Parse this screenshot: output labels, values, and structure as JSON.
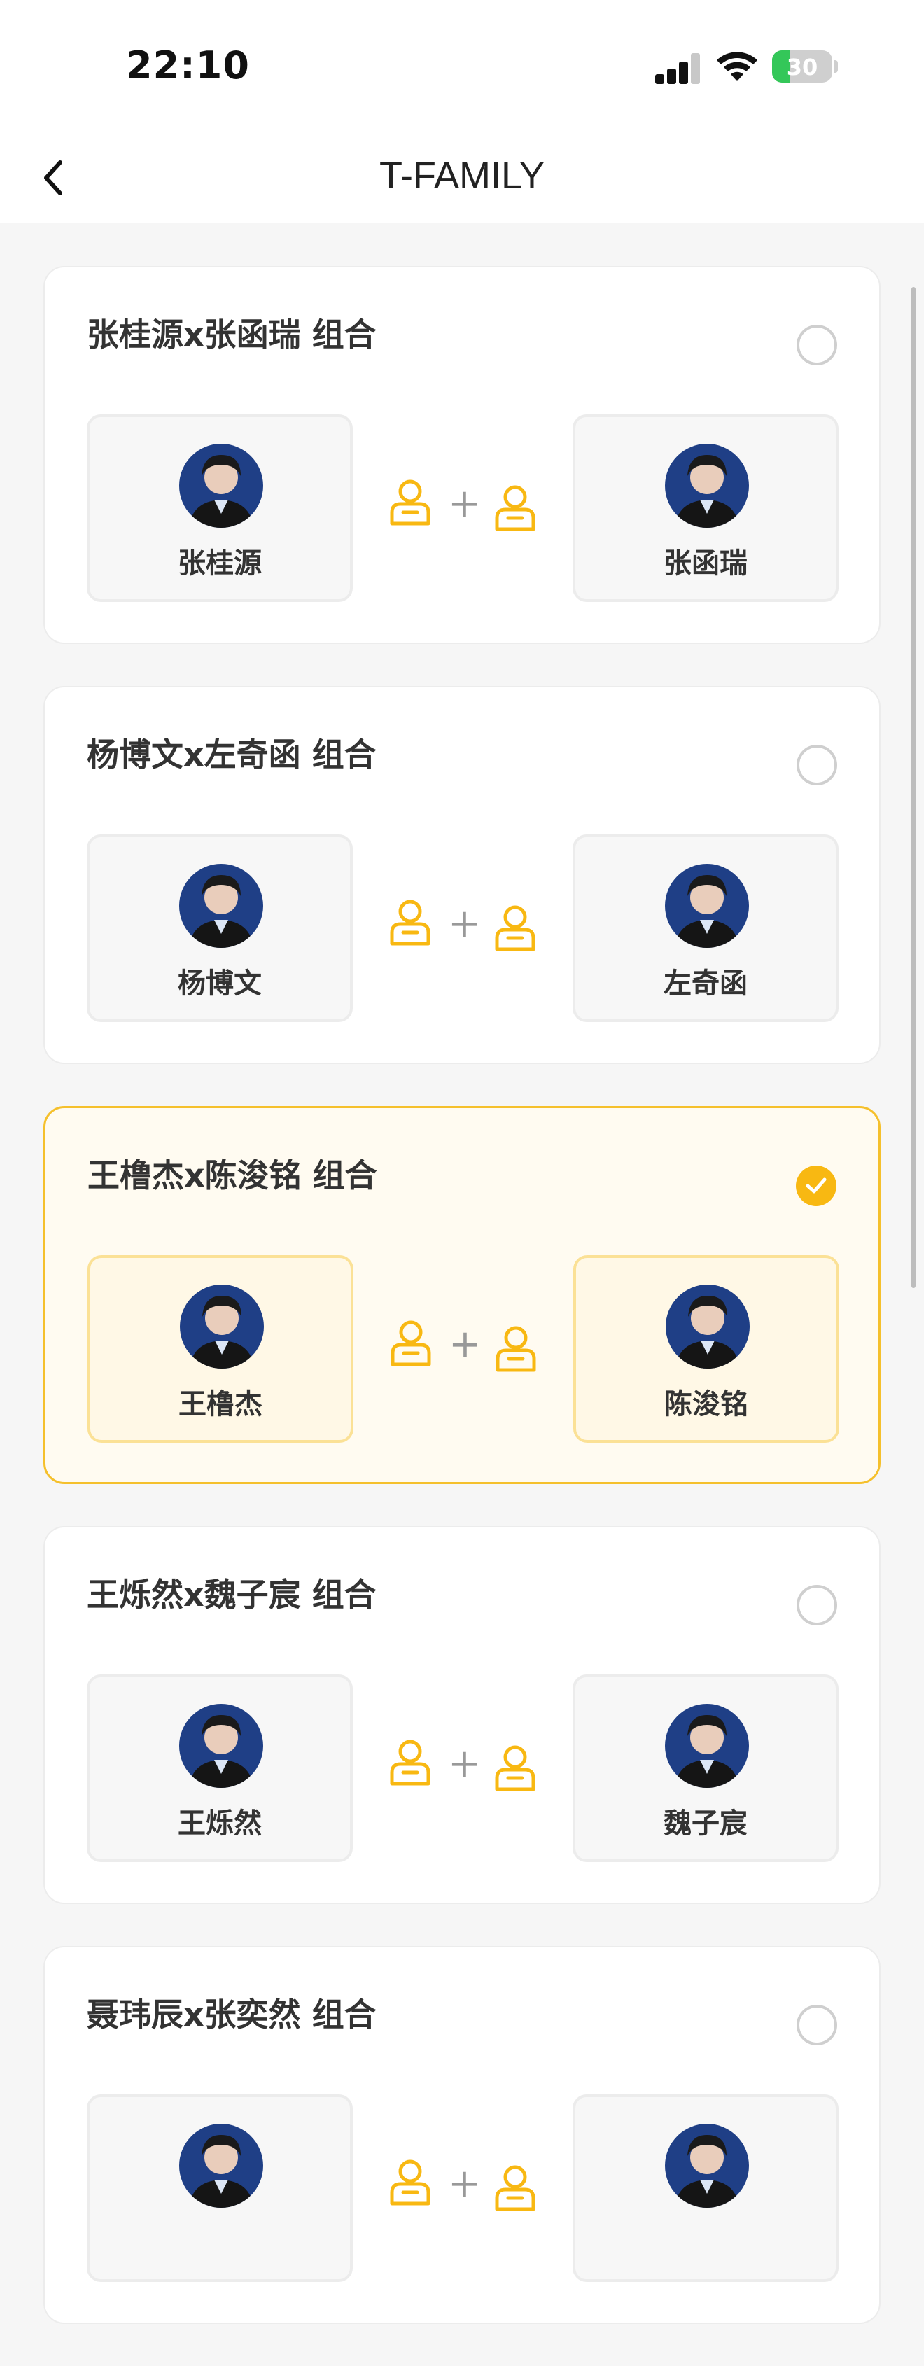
{
  "status_bar": {
    "time": "22:10",
    "battery_level": "30",
    "battery_fraction": 0.3,
    "battery_color": "#34c759",
    "icons": [
      "signal-icon",
      "wifi-icon",
      "battery-icon"
    ]
  },
  "nav": {
    "title": "T-FAMILY",
    "back_icon": "chevron-left-icon"
  },
  "accent_color": "#f8b812",
  "groups": [
    {
      "title": "张桂源x张函瑞 组合",
      "selected": false,
      "members": [
        {
          "name": "张桂源"
        },
        {
          "name": "张函瑞"
        }
      ]
    },
    {
      "title": "杨博文x左奇函 组合",
      "selected": false,
      "members": [
        {
          "name": "杨博文"
        },
        {
          "name": "左奇函"
        }
      ]
    },
    {
      "title": "王橹杰x陈浚铭 组合",
      "selected": true,
      "members": [
        {
          "name": "王橹杰"
        },
        {
          "name": "陈浚铭"
        }
      ]
    },
    {
      "title": "王烁然x魏子宸 组合",
      "selected": false,
      "members": [
        {
          "name": "王烁然"
        },
        {
          "name": "魏子宸"
        }
      ]
    },
    {
      "title": "聂玮辰x张奕然 组合",
      "selected": false,
      "members": [
        {
          "name": ""
        },
        {
          "name": ""
        }
      ]
    }
  ],
  "plus_symbol": "+"
}
